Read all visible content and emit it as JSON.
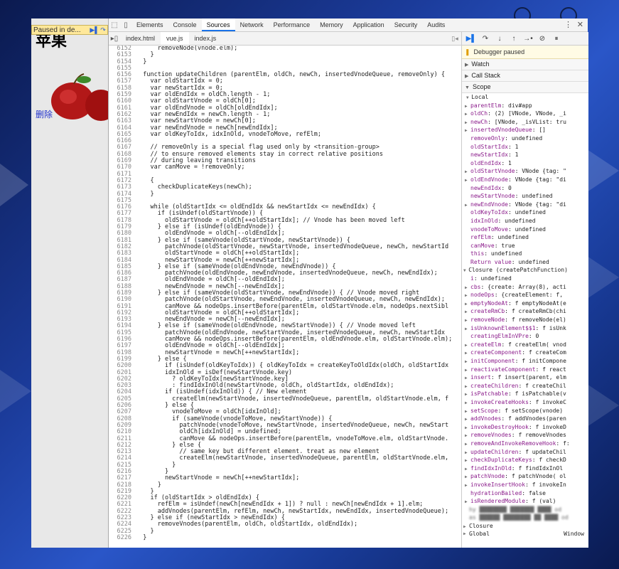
{
  "page": {
    "title": "苹果",
    "delete_link": "删除",
    "paused_banner": "Paused in de..."
  },
  "devtools": {
    "tabs": [
      "Elements",
      "Console",
      "Sources",
      "Network",
      "Performance",
      "Memory",
      "Application",
      "Security",
      "Audits"
    ],
    "active_tab": "Sources",
    "file_tabs": [
      "index.html",
      "vue.js",
      "index.js"
    ],
    "active_file": "vue.js"
  },
  "code_lines": [
    {
      "n": "6152",
      "t": "      removeNode(vnode.elm);"
    },
    {
      "n": "6153",
      "t": "    }"
    },
    {
      "n": "6154",
      "t": "  }"
    },
    {
      "n": "6155",
      "t": ""
    },
    {
      "n": "6156",
      "t": "  function updateChildren (parentElm, oldCh, newCh, insertedVnodeQueue, removeOnly) {"
    },
    {
      "n": "6157",
      "t": "    var oldStartIdx = 0;"
    },
    {
      "n": "6158",
      "t": "    var newStartIdx = 0;"
    },
    {
      "n": "6159",
      "t": "    var oldEndIdx = oldCh.length - 1;"
    },
    {
      "n": "6160",
      "t": "    var oldStartVnode = oldCh[0];"
    },
    {
      "n": "6161",
      "t": "    var oldEndVnode = oldCh[oldEndIdx];"
    },
    {
      "n": "6162",
      "t": "    var newEndIdx = newCh.length - 1;"
    },
    {
      "n": "6163",
      "t": "    var newStartVnode = newCh[0];"
    },
    {
      "n": "6164",
      "t": "    var newEndVnode = newCh[newEndIdx];"
    },
    {
      "n": "6165",
      "t": "    var oldKeyToIdx, idxInOld, vnodeToMove, refElm;"
    },
    {
      "n": "6166",
      "t": ""
    },
    {
      "n": "6167",
      "t": "    // removeOnly is a special flag used only by <transition-group>"
    },
    {
      "n": "6168",
      "t": "    // to ensure removed elements stay in correct relative positions"
    },
    {
      "n": "6169",
      "t": "    // during leaving transitions"
    },
    {
      "n": "6170",
      "t": "    var canMove = !removeOnly;"
    },
    {
      "n": "6171",
      "t": ""
    },
    {
      "n": "6172",
      "t": "    {"
    },
    {
      "n": "6173",
      "t": "      checkDuplicateKeys(newCh);"
    },
    {
      "n": "6174",
      "t": "    }"
    },
    {
      "n": "6175",
      "t": ""
    },
    {
      "n": "6176",
      "t": "    while (oldStartIdx <= oldEndIdx && newStartIdx <= newEndIdx) {"
    },
    {
      "n": "6177",
      "t": "      if (isUndef(oldStartVnode)) {"
    },
    {
      "n": "6178",
      "t": "        oldStartVnode = oldCh[++oldStartIdx]; // Vnode has been moved left"
    },
    {
      "n": "6179",
      "t": "      } else if (isUndef(oldEndVnode)) {"
    },
    {
      "n": "6180",
      "t": "        oldEndVnode = oldCh[--oldEndIdx];"
    },
    {
      "n": "6181",
      "t": "      } else if (sameVnode(oldStartVnode, newStartVnode)) {"
    },
    {
      "n": "6182",
      "t": "        patchVnode(oldStartVnode, newStartVnode, insertedVnodeQueue, newCh, newStartId"
    },
    {
      "n": "6183",
      "t": "        oldStartVnode = oldCh[++oldStartIdx];"
    },
    {
      "n": "6184",
      "t": "        newStartVnode = newCh[++newStartIdx];"
    },
    {
      "n": "6185",
      "t": "      } else if (sameVnode(oldEndVnode, newEndVnode)) {"
    },
    {
      "n": "6186",
      "t": "        patchVnode(oldEndVnode, newEndVnode, insertedVnodeQueue, newCh, newEndIdx);"
    },
    {
      "n": "6187",
      "t": "        oldEndVnode = oldCh[--oldEndIdx];"
    },
    {
      "n": "6188",
      "t": "        newEndVnode = newCh[--newEndIdx];"
    },
    {
      "n": "6189",
      "t": "      } else if (sameVnode(oldStartVnode, newEndVnode)) { // Vnode moved right"
    },
    {
      "n": "6190",
      "t": "        patchVnode(oldStartVnode, newEndVnode, insertedVnodeQueue, newCh, newEndIdx);"
    },
    {
      "n": "6191",
      "t": "        canMove && nodeOps.insertBefore(parentElm, oldStartVnode.elm, nodeOps.nextSibl"
    },
    {
      "n": "6192",
      "t": "        oldStartVnode = oldCh[++oldStartIdx];"
    },
    {
      "n": "6193",
      "t": "        newEndVnode = newCh[--newEndIdx];"
    },
    {
      "n": "6194",
      "t": "      } else if (sameVnode(oldEndVnode, newStartVnode)) { // Vnode moved left"
    },
    {
      "n": "6195",
      "t": "        patchVnode(oldEndVnode, newStartVnode, insertedVnodeQueue, newCh, newStartIdx"
    },
    {
      "n": "6196",
      "t": "        canMove && nodeOps.insertBefore(parentElm, oldEndVnode.elm, oldStartVnode.elm);"
    },
    {
      "n": "6197",
      "t": "        oldEndVnode = oldCh[--oldEndIdx];"
    },
    {
      "n": "6198",
      "t": "        newStartVnode = newCh[++newStartIdx];"
    },
    {
      "n": "6199",
      "t": "      } else {"
    },
    {
      "n": "6200",
      "t": "        if (isUndef(oldKeyToIdx)) { oldKeyToIdx = createKeyToOldIdx(oldCh, oldStartIdx"
    },
    {
      "n": "6201",
      "t": "        idxInOld = isDef(newStartVnode.key)"
    },
    {
      "n": "6202",
      "t": "          ? oldKeyToIdx[newStartVnode.key]"
    },
    {
      "n": "6203",
      "t": "          : findIdxInOld(newStartVnode, oldCh, oldStartIdx, oldEndIdx);"
    },
    {
      "n": "6204",
      "t": "        if (isUndef(idxInOld)) { // New element"
    },
    {
      "n": "6205",
      "t": "          createElm(newStartVnode, insertedVnodeQueue, parentElm, oldStartVnode.elm, f"
    },
    {
      "n": "6206",
      "t": "        } else {"
    },
    {
      "n": "6207",
      "t": "          vnodeToMove = oldCh[idxInOld];"
    },
    {
      "n": "6208",
      "t": "          if (sameVnode(vnodeToMove, newStartVnode)) {"
    },
    {
      "n": "6209",
      "t": "            patchVnode(vnodeToMove, newStartVnode, insertedVnodeQueue, newCh, newStart"
    },
    {
      "n": "6210",
      "t": "            oldCh[idxInOld] = undefined;"
    },
    {
      "n": "6211",
      "t": "            canMove && nodeOps.insertBefore(parentElm, vnodeToMove.elm, oldStartVnode."
    },
    {
      "n": "6212",
      "t": "          } else {"
    },
    {
      "n": "6213",
      "t": "            // same key but different element. treat as new element"
    },
    {
      "n": "6214",
      "t": "            createElm(newStartVnode, insertedVnodeQueue, parentElm, oldStartVnode.elm,"
    },
    {
      "n": "6215",
      "t": "          }"
    },
    {
      "n": "6216",
      "t": "        }"
    },
    {
      "n": "6217",
      "t": "        newStartVnode = newCh[++newStartIdx];"
    },
    {
      "n": "6218",
      "t": "      }"
    },
    {
      "n": "6219",
      "t": "    }"
    },
    {
      "n": "6220",
      "t": "    if (oldStartIdx > oldEndIdx) {"
    },
    {
      "n": "6221",
      "t": "      refElm = isUndef(newCh[newEndIdx + 1]) ? null : newCh[newEndIdx + 1].elm;"
    },
    {
      "n": "6222",
      "t": "      addVnodes(parentElm, refElm, newCh, newStartIdx, newEndIdx, insertedVnodeQueue);"
    },
    {
      "n": "6223",
      "t": "    } else if (newStartIdx > newEndIdx) {"
    },
    {
      "n": "6224",
      "t": "      removeVnodes(parentElm, oldCh, oldStartIdx, oldEndIdx);"
    },
    {
      "n": "6225",
      "t": "    }"
    },
    {
      "n": "6226",
      "t": "  }"
    }
  ],
  "debugger": {
    "paused_text": "Debugger paused",
    "sections": [
      "Watch",
      "Call Stack",
      "Scope"
    ],
    "local_header": "Local",
    "closure_header": "Closure (createPatchFunction)",
    "global_sections": [
      "Closure",
      "Global"
    ],
    "global_value": "Window",
    "local_vars": [
      {
        "e": true,
        "k": "parentElm",
        "v": "div#app"
      },
      {
        "e": true,
        "k": "oldCh",
        "v": "(2) [VNode, VNode, _i"
      },
      {
        "e": true,
        "k": "newCh",
        "v": "[VNode, _isVList: tru"
      },
      {
        "e": true,
        "k": "insertedVnodeQueue",
        "v": "[]"
      },
      {
        "e": false,
        "k": "removeOnly",
        "v": "undefined"
      },
      {
        "e": false,
        "k": "oldStartIdx",
        "v": "1"
      },
      {
        "e": false,
        "k": "newStartIdx",
        "v": "1"
      },
      {
        "e": false,
        "k": "oldEndIdx",
        "v": "1"
      },
      {
        "e": true,
        "k": "oldStartVnode",
        "v": "VNode {tag: \""
      },
      {
        "e": true,
        "k": "oldEndVnode",
        "v": "VNode {tag: \"di"
      },
      {
        "e": false,
        "k": "newEndIdx",
        "v": "0"
      },
      {
        "e": false,
        "k": "newStartVnode",
        "v": "undefined"
      },
      {
        "e": true,
        "k": "newEndVnode",
        "v": "VNode {tag: \"di"
      },
      {
        "e": false,
        "k": "oldKeyToIdx",
        "v": "undefined"
      },
      {
        "e": false,
        "k": "idxInOld",
        "v": "undefined"
      },
      {
        "e": false,
        "k": "vnodeToMove",
        "v": "undefined"
      },
      {
        "e": false,
        "k": "refElm",
        "v": "undefined"
      },
      {
        "e": false,
        "k": "canMove",
        "v": "true"
      },
      {
        "e": false,
        "k": "this",
        "v": "undefined"
      },
      {
        "e": false,
        "k": "Return value",
        "v": "undefined"
      }
    ],
    "closure_vars": [
      {
        "e": false,
        "k": "i",
        "v": "undefined"
      },
      {
        "e": true,
        "k": "cbs",
        "v": "{create: Array(8), acti"
      },
      {
        "e": true,
        "k": "nodeOps",
        "v": "{createElement: f, "
      },
      {
        "e": true,
        "k": "emptyNodeAt",
        "v": "f emptyNodeAt(e"
      },
      {
        "e": true,
        "k": "createRmCb",
        "v": "f createRmCb(chi"
      },
      {
        "e": true,
        "k": "removeNode",
        "v": "f removeNode(el)"
      },
      {
        "e": true,
        "k": "isUnknownElement$$1",
        "v": "f isUnk"
      },
      {
        "e": false,
        "k": "creatingElmInVPre",
        "v": "0"
      },
      {
        "e": true,
        "k": "createElm",
        "v": "f createElm( vnod"
      },
      {
        "e": true,
        "k": "createComponent",
        "v": "f createCom"
      },
      {
        "e": true,
        "k": "initComponent",
        "v": "f initCompone"
      },
      {
        "e": true,
        "k": "reactivateComponent",
        "v": "f react"
      },
      {
        "e": true,
        "k": "insert",
        "v": "f insert(parent, elm"
      },
      {
        "e": true,
        "k": "createChildren",
        "v": "f createChil"
      },
      {
        "e": true,
        "k": "isPatchable",
        "v": "f isPatchable(v"
      },
      {
        "e": true,
        "k": "invokeCreateHooks",
        "v": "f invokeC"
      },
      {
        "e": true,
        "k": "setScope",
        "v": "f setScope(vnode)"
      },
      {
        "e": true,
        "k": "addVnodes",
        "v": "f addVnodes(paren"
      },
      {
        "e": true,
        "k": "invokeDestroyHook",
        "v": "f invokeD"
      },
      {
        "e": true,
        "k": "removeVnodes",
        "v": "f removeVnodes"
      },
      {
        "e": true,
        "k": "removeAndInvokeRemoveHook",
        "v": "f:"
      },
      {
        "e": true,
        "k": "updateChildren",
        "v": "f updateChil"
      },
      {
        "e": true,
        "k": "checkDuplicateKeys",
        "v": "f checkD"
      },
      {
        "e": true,
        "k": "findIdxInOld",
        "v": "f findIdxInOl"
      },
      {
        "e": true,
        "k": "patchVnode",
        "v": "f patchVnode( ol"
      },
      {
        "e": true,
        "k": "invokeInsertHook",
        "v": "f invokeIn"
      },
      {
        "e": false,
        "k": "hydrationBailed",
        "v": "false"
      },
      {
        "e": true,
        "k": "isRenderedModule",
        "v": "f (val)"
      }
    ]
  },
  "colors": {
    "accent": "#1a73e8",
    "paused_banner": "#ffe89a",
    "scope_key": "#8a1a8a"
  }
}
